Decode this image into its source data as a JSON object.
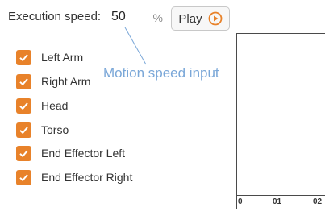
{
  "header": {
    "speed_label": "Execution speed:",
    "speed_value": "50",
    "speed_unit": "%",
    "play_label": "Play",
    "play_icon": "play-circle-icon"
  },
  "annotation": "Motion speed input",
  "colors": {
    "accent": "#e8822a",
    "annotation": "#7aa7d8"
  },
  "checklist": [
    {
      "label": "Left Arm",
      "checked": true
    },
    {
      "label": "Right Arm",
      "checked": true
    },
    {
      "label": "Head",
      "checked": true
    },
    {
      "label": "Torso",
      "checked": true
    },
    {
      "label": "End Effector Left",
      "checked": true
    },
    {
      "label": "End Effector Right",
      "checked": true
    }
  ],
  "timeline": {
    "ticks": [
      "0",
      "01",
      "02"
    ]
  }
}
